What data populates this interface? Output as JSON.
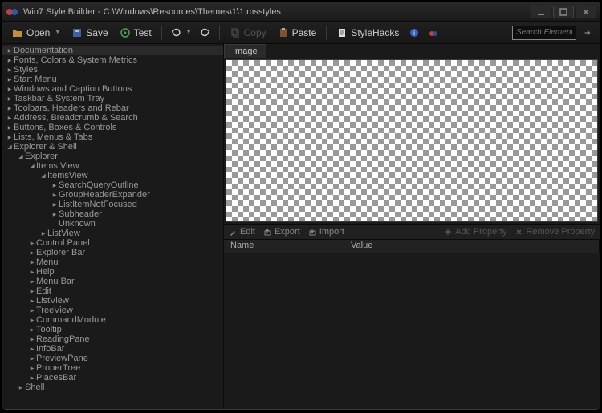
{
  "window": {
    "title": "Win7 Style Builder - C:\\Windows\\Resources\\Themes\\1\\1.msstyles"
  },
  "toolbar": {
    "open": "Open",
    "save": "Save",
    "test": "Test",
    "copy": "Copy",
    "paste": "Paste",
    "stylehacks": "StyleHacks",
    "search_placeholder": "Search Elements"
  },
  "tree": [
    {
      "label": "Documentation",
      "depth": 0,
      "state": "collapsed",
      "hl": true
    },
    {
      "label": "Fonts, Colors & System Metrics",
      "depth": 0,
      "state": "collapsed"
    },
    {
      "label": "Styles",
      "depth": 0,
      "state": "collapsed"
    },
    {
      "label": "Start Menu",
      "depth": 0,
      "state": "collapsed"
    },
    {
      "label": "Windows and Caption Buttons",
      "depth": 0,
      "state": "collapsed"
    },
    {
      "label": "Taskbar & System Tray",
      "depth": 0,
      "state": "collapsed"
    },
    {
      "label": "Toolbars, Headers and Rebar",
      "depth": 0,
      "state": "collapsed"
    },
    {
      "label": "Address, Breadcrumb & Search",
      "depth": 0,
      "state": "collapsed"
    },
    {
      "label": "Buttons, Boxes & Controls",
      "depth": 0,
      "state": "collapsed"
    },
    {
      "label": "Lists, Menus & Tabs",
      "depth": 0,
      "state": "collapsed"
    },
    {
      "label": "Explorer & Shell",
      "depth": 0,
      "state": "expanded"
    },
    {
      "label": "Explorer",
      "depth": 1,
      "state": "expanded"
    },
    {
      "label": "Items View",
      "depth": 2,
      "state": "expanded"
    },
    {
      "label": "ItemsView",
      "depth": 3,
      "state": "expanded"
    },
    {
      "label": "SearchQueryOutline",
      "depth": 4,
      "state": "collapsed"
    },
    {
      "label": "GroupHeaderExpander",
      "depth": 4,
      "state": "collapsed"
    },
    {
      "label": "ListItemNotFocused",
      "depth": 4,
      "state": "collapsed"
    },
    {
      "label": "Subheader",
      "depth": 4,
      "state": "collapsed"
    },
    {
      "label": "Unknown",
      "depth": 4,
      "state": "none"
    },
    {
      "label": "ListView",
      "depth": 3,
      "state": "collapsed"
    },
    {
      "label": "Control Panel",
      "depth": 2,
      "state": "collapsed"
    },
    {
      "label": "Explorer Bar",
      "depth": 2,
      "state": "collapsed"
    },
    {
      "label": "Menu",
      "depth": 2,
      "state": "collapsed"
    },
    {
      "label": "Help",
      "depth": 2,
      "state": "collapsed"
    },
    {
      "label": "Menu Bar",
      "depth": 2,
      "state": "collapsed"
    },
    {
      "label": "Edit",
      "depth": 2,
      "state": "collapsed"
    },
    {
      "label": "ListView",
      "depth": 2,
      "state": "collapsed"
    },
    {
      "label": "TreeView",
      "depth": 2,
      "state": "collapsed"
    },
    {
      "label": "CommandModule",
      "depth": 2,
      "state": "collapsed"
    },
    {
      "label": "Tooltip",
      "depth": 2,
      "state": "collapsed"
    },
    {
      "label": "ReadingPane",
      "depth": 2,
      "state": "collapsed"
    },
    {
      "label": "InfoBar",
      "depth": 2,
      "state": "collapsed"
    },
    {
      "label": "PreviewPane",
      "depth": 2,
      "state": "collapsed"
    },
    {
      "label": "ProperTree",
      "depth": 2,
      "state": "collapsed"
    },
    {
      "label": "PlacesBar",
      "depth": 2,
      "state": "collapsed"
    },
    {
      "label": "Shell",
      "depth": 1,
      "state": "collapsed"
    }
  ],
  "image_panel": {
    "tab": "Image"
  },
  "props_toolbar": {
    "edit": "Edit",
    "export": "Export",
    "import": "Import",
    "add_property": "Add Property",
    "remove_property": "Remove Property"
  },
  "props_columns": {
    "name": "Name",
    "value": "Value"
  }
}
